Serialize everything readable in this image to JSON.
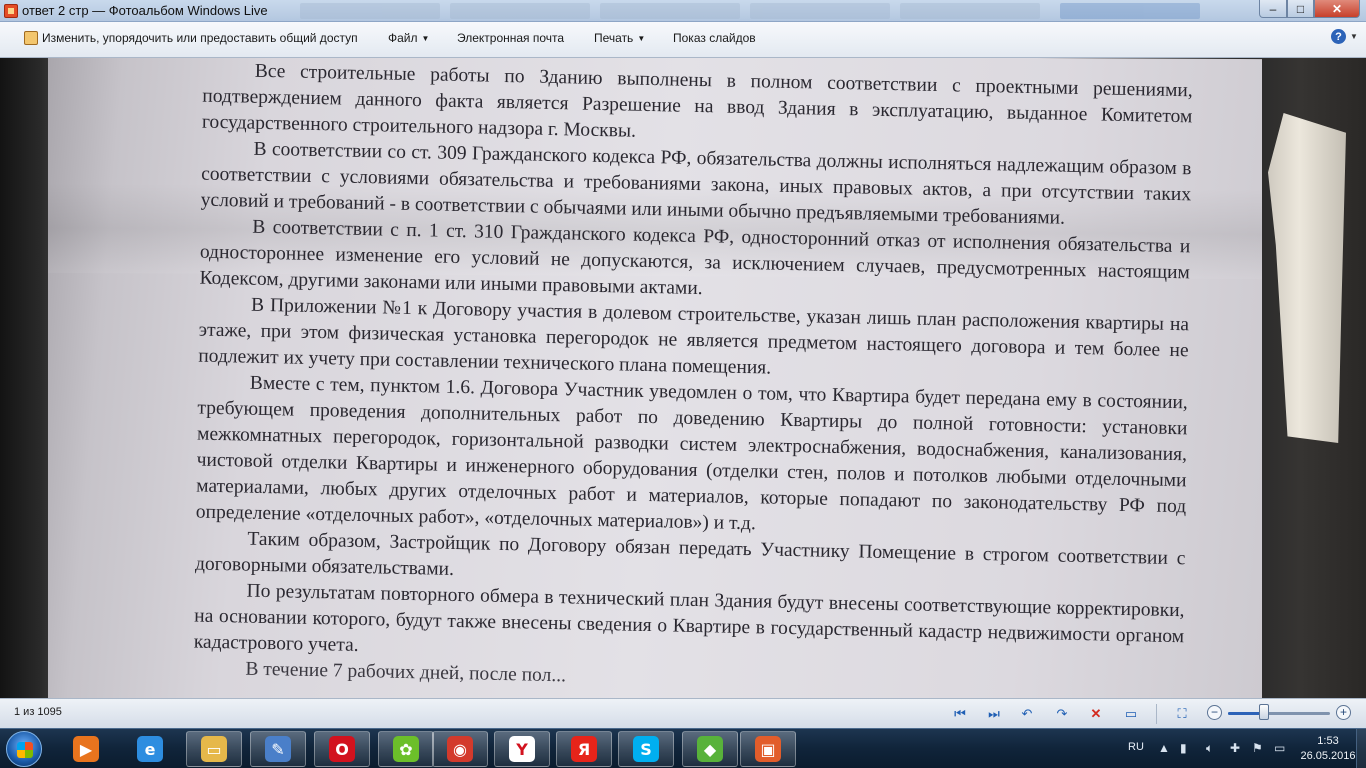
{
  "window": {
    "title": "ответ 2 стр — Фотоальбом Windows Live",
    "controls": {
      "minimize": "–",
      "maximize": "□",
      "close": "✕"
    }
  },
  "toolbar": {
    "share_label": "Изменить, упорядочить или предоставить общий доступ",
    "file_label": "Файл",
    "email_label": "Электронная почта",
    "print_label": "Печать",
    "slideshow_label": "Показ слайдов",
    "help_label": "?"
  },
  "document": {
    "paragraphs": [
      "Все строительные работы по Зданию выполнены в полном соответствии с проектными решениями, подтверждением данного факта является Разрешение на ввод Здания в эксплуатацию, выданное Комитетом государственного строительного надзора г. Москвы.",
      "В соответствии со ст. 309 Гражданского кодекса РФ, обязательства должны исполняться надлежащим образом в соответствии с условиями обязательства и требованиями закона, иных правовых актов, а при отсутствии таких условий и требований - в соответствии с обычаями или иными обычно предъявляемыми требованиями.",
      "В соответствии с п. 1 ст. 310 Гражданского кодекса РФ,  односторонний отказ от исполнения обязательства и одностороннее изменение его условий не допускаются, за исключением случаев, предусмотренных настоящим Кодексом, другими законами или иными правовыми актами.",
      "В Приложении №1 к Договору участия в долевом строительстве, указан лишь план расположения квартиры на этаже, при этом физическая установка перегородок не является предметом настоящего договора и тем более не подлежит их учету при составлении технического плана помещения.",
      "Вместе с тем, пунктом 1.6. Договора Участник уведомлен о том, что Квартира  будет передана ему в состоянии, требующем проведения дополнительных работ по доведению Квартиры до полной готовности: установки межкомнатных перегородок, горизонтальной разводки систем электроснабжения, водоснабжения, канализования, чистовой отделки Квартиры и инженерного оборудования (отделки стен, полов и потолков любыми отделочными материалами, любых других отделочных работ и материалов, которые попадают по законодательству РФ под определение «отделочных работ», «отделочных материалов») и т.д.",
      "Таким образом, Застройщик по Договору обязан передать Участнику Помещение в строгом соответствии с договорными обязательствами.",
      "По результатам повторного обмера в технический план Здания будут внесены соответствующие корректировки, на основании которого, будут также внесены сведения о Квартире в государственный кадастр недвижимости органом кадастрового учета.",
      "В течение 7 рабочих дней, после пол..."
    ]
  },
  "controls": {
    "counter": "1 из 1095",
    "zoom_level": 0.35
  },
  "taskbar": {
    "apps": [
      {
        "icon": "media-player-icon",
        "color": "#e8741e",
        "glyph": "▶"
      },
      {
        "icon": "internet-explorer-icon",
        "color": "#2d8de0",
        "glyph": "e"
      },
      {
        "icon": "file-explorer-icon",
        "color": "#e6b84a",
        "glyph": "▭"
      },
      {
        "icon": "paint-icon",
        "color": "#4a7fc9",
        "glyph": "✎"
      },
      {
        "icon": "opera-icon",
        "color": "#d2121e",
        "glyph": "O"
      },
      {
        "icon": "browser-frog-icon",
        "color": "#6cbf2a",
        "glyph": "✿"
      },
      {
        "icon": "chrome-icon",
        "color": "#d33a2c",
        "glyph": "◉"
      },
      {
        "icon": "yandex-browser-icon",
        "color": "#ffffff",
        "glyph": "Y"
      },
      {
        "icon": "yandex-icon",
        "color": "#e7241a",
        "glyph": "Я"
      },
      {
        "icon": "skype-icon",
        "color": "#00aff0",
        "glyph": "S"
      },
      {
        "icon": "bluestacks-icon",
        "color": "#58b23a",
        "glyph": "◆"
      },
      {
        "icon": "photo-gallery-icon",
        "color": "#e25d2b",
        "glyph": "▣"
      }
    ],
    "tray": {
      "language": "RU",
      "time": "1:53",
      "date": "26.05.2016"
    }
  },
  "colors": {
    "titlebar": "#b3c7e0",
    "taskbar": "#10243a",
    "paper": "#e3e1e6",
    "close_button": "#c7402b"
  }
}
